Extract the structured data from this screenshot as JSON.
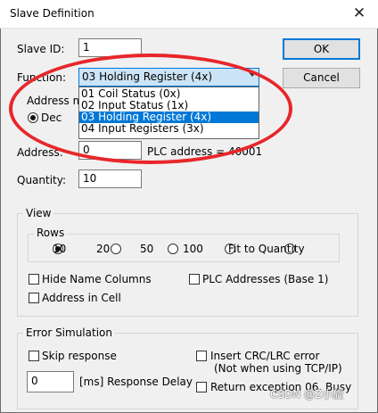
{
  "window": {
    "title": "Slave Definition",
    "close_glyph": "✕"
  },
  "slave_id": {
    "label": "Slave ID:",
    "value": "1"
  },
  "buttons": {
    "ok": "OK",
    "cancel": "Cancel"
  },
  "function": {
    "label": "Function:",
    "selected": "03 Holding Register (4x)",
    "options": [
      "01 Coil Status (0x)",
      "02 Input Status (1x)",
      "03 Holding Register (4x)",
      "04 Input Registers (3x)"
    ]
  },
  "address_mode": {
    "label": "Address mo",
    "dec": "Dec"
  },
  "address": {
    "label": "Address:",
    "value": "0",
    "plc_text": "PLC address = 40001"
  },
  "quantity": {
    "label": "Quantity:",
    "value": "10"
  },
  "view": {
    "label": "View",
    "rows_label": "Rows",
    "rows_options": [
      "10",
      "20",
      "50",
      "100",
      "Fit to Quantity"
    ],
    "rows_selected": "10",
    "hide_name_columns": "Hide Name Columns",
    "plc_addresses": "PLC Addresses (Base 1)",
    "address_in_cell": "Address in Cell"
  },
  "error_simulation": {
    "label": "Error Simulation",
    "skip_response": "Skip response",
    "insert_crc": "Insert CRC/LRC error",
    "insert_crc_note": "(Not when using TCP/IP)",
    "delay_value": "0",
    "delay_label": "[ms] Response Delay",
    "return_exception": "Return exception 06, Busy"
  },
  "watermark": "CSDN @Z小旋",
  "colors": {
    "highlight": "#0078d7",
    "annotation_ring": "#e8262a",
    "window_bg": "#f0f0f0"
  }
}
